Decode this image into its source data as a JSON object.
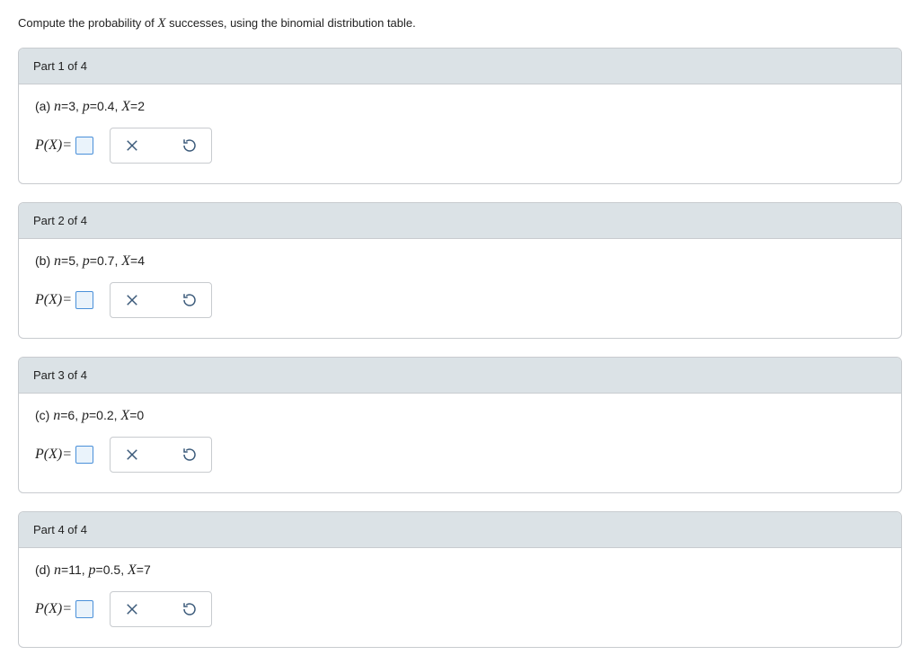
{
  "instruction_prefix": "Compute the probability of ",
  "instruction_var": "X",
  "instruction_suffix": " successes, using the binomial distribution table.",
  "px_label": "P(X)=",
  "parts": [
    {
      "header": "Part 1 of 4",
      "label": "(a)",
      "n": "3",
      "p": "0.4",
      "X": "2"
    },
    {
      "header": "Part 2 of 4",
      "label": "(b)",
      "n": "5",
      "p": "0.7",
      "X": "4"
    },
    {
      "header": "Part 3 of 4",
      "label": "(c)",
      "n": "6",
      "p": "0.2",
      "X": "0"
    },
    {
      "header": "Part 4 of 4",
      "label": "(d)",
      "n": "11",
      "p": "0.5",
      "X": "7"
    }
  ]
}
